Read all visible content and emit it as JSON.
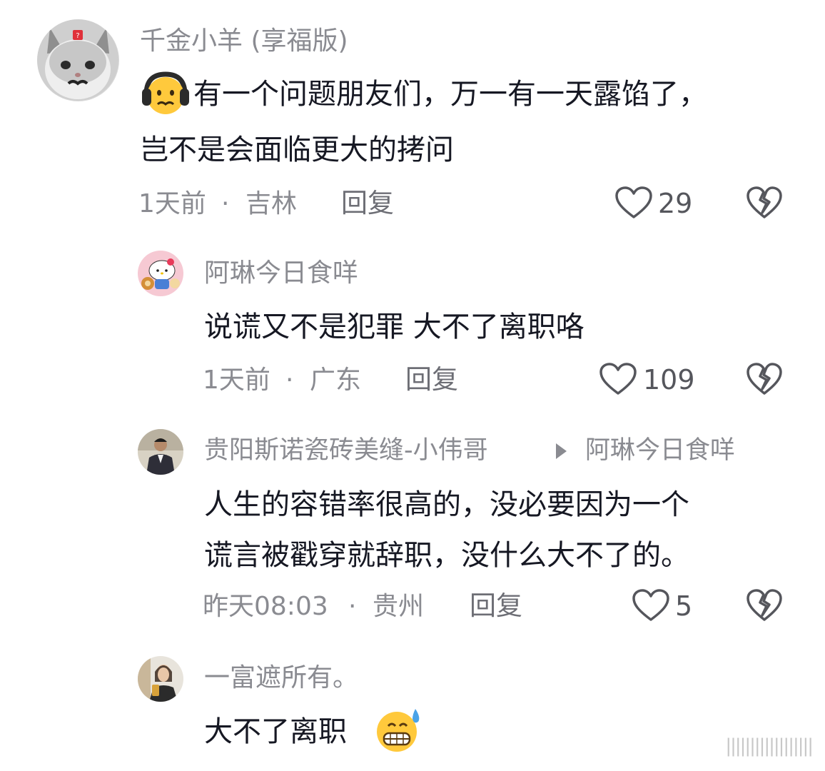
{
  "comments": [
    {
      "username": "千金小羊 (享福版)",
      "text_line1": "有一个问题朋友们，万一有一天露馅了，",
      "text_line2": "岂不是会面临更大的拷问",
      "time": "1天前",
      "location": "吉林",
      "reply_label": "回复",
      "likes": "29",
      "avatar_icon": "kitten-avatar",
      "emoji_icon": "headphones-grimace-emoji"
    },
    {
      "username": "阿琳今日食咩",
      "text": "说谎又不是犯罪 大不了离职咯",
      "time": "1天前",
      "location": "广东",
      "reply_label": "回复",
      "likes": "109",
      "avatar_icon": "hello-kitty-avatar"
    },
    {
      "username": "贵阳斯诺瓷砖美缝-小伟哥",
      "reply_to": "阿琳今日食咩",
      "text_line1": "人生的容错率很高的，没必要因为一个",
      "text_line2": "谎言被戳穿就辞职，没什么大不了的。",
      "time": "昨天08:03",
      "location": "贵州",
      "reply_label": "回复",
      "likes": "5",
      "avatar_icon": "man-photo-avatar"
    },
    {
      "username": "一富遮所有。",
      "text": "大不了离职",
      "avatar_icon": "woman-selfie-avatar",
      "emoji_icon": "grin-sweat-emoji"
    }
  ],
  "separator": "·",
  "watermark": "||||||||||||||||||",
  "colors": {
    "text": "#161823",
    "secondary": "#8a8b91",
    "icon": "#55565c",
    "background": "#ffffff"
  }
}
